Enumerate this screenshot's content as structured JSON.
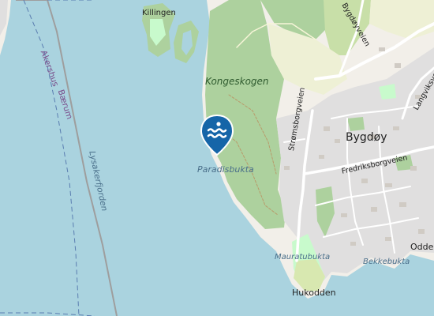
{
  "map": {
    "colors": {
      "water": "#aad3df",
      "land": "#f2efe9",
      "forest": "#add19e",
      "park": "#c8facc",
      "farmland": "#eef0d5",
      "residential": "#e0dfdf",
      "road": "#ffffff",
      "boundary": "#9e9e9e",
      "pin": "#1565a8"
    },
    "labels": {
      "killingen": "Killingen",
      "kongeskogen": "Kongeskogen",
      "paradisbukta": "Paradisbukta",
      "bygdoy": "Bygdøy",
      "stromsborgveien": "Strømsborgveien",
      "fredriksborgveien": "Fredriksborgveien",
      "langviksveien": "Langviksveie",
      "bygdoyveien": "Bygdøyveien",
      "akershus": "Akershus",
      "baerum": "Bærum",
      "lysakerfjorden": "Lysakerfjorden",
      "mauratubukta": "Mauratubukta",
      "bekkebukta": "Bekkebukta",
      "hukodden": "Hukodden",
      "odden": "Odden"
    },
    "marker": {
      "icon": "swimming-icon",
      "type": "beach-pin"
    }
  }
}
